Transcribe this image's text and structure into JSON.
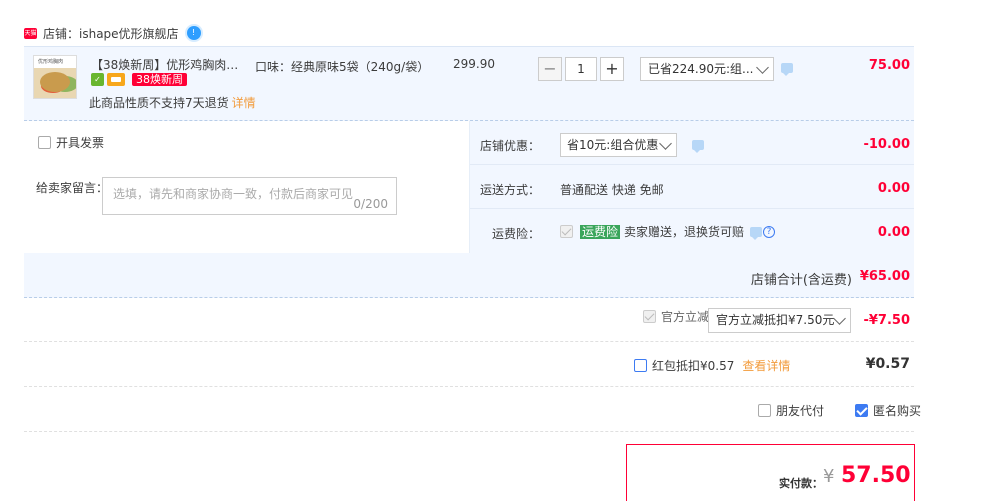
{
  "shop": {
    "label": "店铺：ishape优形旗舰店",
    "tmall_icon_text": "天猫",
    "badge_text": "!"
  },
  "item": {
    "thumb_text": "优形鸡胸肉",
    "title": "【38焕新周】优形鸡胸肉蒸麦...",
    "promo_badge": "38焕新周",
    "no_return": "此商品性质不支持7天退货",
    "detail_link": "详情",
    "sku": "口味：经典原味5袋（240g/袋）",
    "unit_price": "299.90",
    "qty_minus": "−",
    "qty_value": "1",
    "qty_plus": "+",
    "discount_select": "已省224.90元:组...",
    "total": "75.00"
  },
  "options": {
    "invoice_label": "开具发票",
    "message_label": "给卖家留言：",
    "message_placeholder": "选填，请先和商家协商一致，付款后商家可见",
    "message_count": "0/200",
    "shop_discount_label": "店铺优惠：",
    "shop_discount_select": "省10元:组合优惠",
    "shop_discount_value": "-10.00",
    "shipping_label": "运送方式：",
    "shipping_text": "普通配送 快递 免邮",
    "shipping_value": "0.00",
    "insurance_label": "运费险：",
    "insurance_tag": "运费险",
    "insurance_text": "卖家赠送，退换货可赔",
    "insurance_help": "?",
    "insurance_value": "0.00",
    "shop_total_label": "店铺合计(含运费)",
    "shop_total_value": "¥65.00"
  },
  "summary": {
    "official_label": "官方立减",
    "official_select": "官方立减抵扣¥7.50元",
    "official_value": "-¥7.50",
    "redpack_label": "红包抵扣¥0.57",
    "redpack_link": "查看详情",
    "redpack_value": "¥0.57",
    "friend_pay_label": "朋友代付",
    "anonymous_label": "匿名购买",
    "pay_label": "实付款：",
    "pay_yen": "¥",
    "pay_amount": "57.50"
  },
  "colors": {
    "accent": "#ff0036",
    "row_bg": "#f2f7ff",
    "link_orange": "#f29b3b",
    "check_blue": "#3d7bf2"
  }
}
